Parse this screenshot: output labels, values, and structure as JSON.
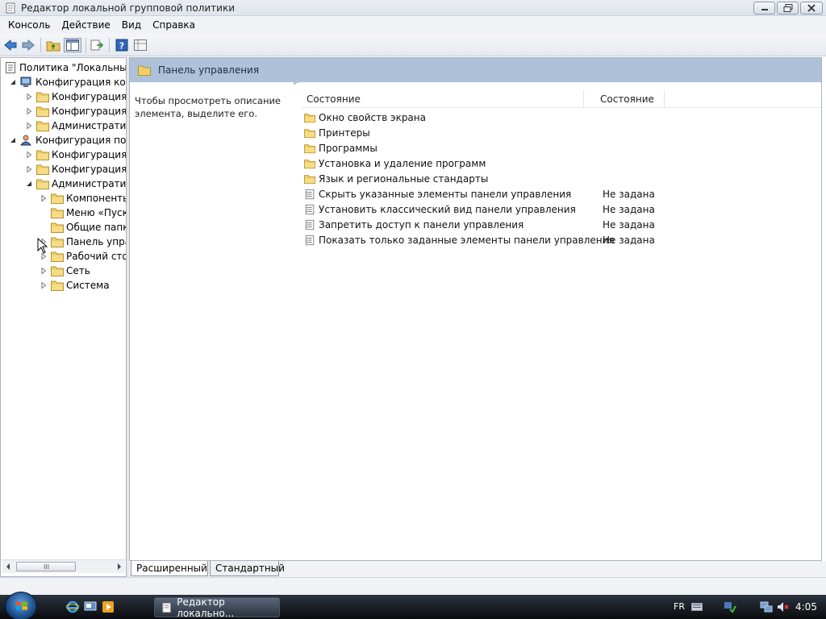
{
  "window": {
    "title": "Редактор локальной групповой политики",
    "title_icon": "policy-editor-icon",
    "controls": [
      "minimize-icon",
      "maximize-icon",
      "close-icon"
    ]
  },
  "menu": [
    "Консоль",
    "Действие",
    "Вид",
    "Справка"
  ],
  "toolbar": {
    "buttons": [
      "back-arrow-icon",
      "forward-arrow-icon",
      "up-folder-icon",
      "show-hide-tree-icon",
      "export-list-icon",
      "help-icon",
      "properties-icon"
    ]
  },
  "tree": {
    "items": [
      {
        "label": "Политика \"Локальный",
        "icon": "policy-icon",
        "expander": "none"
      },
      {
        "label": "Конфигурация комп",
        "icon": "computer-icon",
        "expander": "expanded"
      },
      {
        "label": "Конфигурация п",
        "icon": "folder-icon",
        "expander": "collapsed"
      },
      {
        "label": "Конфигурация W",
        "icon": "folder-icon",
        "expander": "collapsed"
      },
      {
        "label": "Административн",
        "icon": "folder-icon",
        "expander": "collapsed"
      },
      {
        "label": "Конфигурация поль",
        "icon": "user-icon",
        "expander": "expanded"
      },
      {
        "label": "Конфигурация п",
        "icon": "folder-icon",
        "expander": "collapsed"
      },
      {
        "label": "Конфигурация W",
        "icon": "folder-icon",
        "expander": "collapsed"
      },
      {
        "label": "Административн",
        "icon": "folder-icon",
        "expander": "expanded"
      },
      {
        "label": "Компоненты",
        "icon": "folder-icon",
        "expander": "collapsed"
      },
      {
        "label": "Меню «Пуск",
        "icon": "folder-icon",
        "expander": "none"
      },
      {
        "label": "Общие папки",
        "icon": "folder-icon",
        "expander": "none"
      },
      {
        "label": "Панель упра",
        "icon": "folder-icon",
        "expander": "collapsed"
      },
      {
        "label": "Рабочий сто",
        "icon": "folder-icon",
        "expander": "collapsed"
      },
      {
        "label": "Сеть",
        "icon": "folder-icon",
        "expander": "collapsed"
      },
      {
        "label": "Система",
        "icon": "folder-icon",
        "expander": "collapsed"
      }
    ],
    "scroll_grip": "III"
  },
  "right_pane": {
    "header_title": "Панель управления",
    "header_icon": "folder-icon",
    "description": "Чтобы просмотреть описание элемента, выделите его.",
    "columns": [
      "Состояние",
      "Состояние"
    ],
    "rows": [
      {
        "name": "Окно свойств экрана",
        "state": "",
        "icon": "folder-icon"
      },
      {
        "name": "Принтеры",
        "state": "",
        "icon": "folder-icon"
      },
      {
        "name": "Программы",
        "state": "",
        "icon": "folder-icon"
      },
      {
        "name": "Установка и удаление программ",
        "state": "",
        "icon": "folder-icon"
      },
      {
        "name": "Язык и региональные стандарты",
        "state": "",
        "icon": "folder-icon"
      },
      {
        "name": "Скрыть указанные элементы панели управления",
        "state": "Не задана",
        "icon": "setting-icon"
      },
      {
        "name": "Установить классический вид панели управления",
        "state": "Не задана",
        "icon": "setting-icon"
      },
      {
        "name": "Запретить доступ к панели управления",
        "state": "Не задана",
        "icon": "setting-icon"
      },
      {
        "name": "Показать только заданные элементы панели управления",
        "state": "Не задана",
        "icon": "setting-icon"
      }
    ]
  },
  "tabs": [
    "Расширенный",
    "Стандартный"
  ],
  "taskbar": {
    "task_label": "Редактор локально...",
    "language": "FR",
    "clock": "4:05",
    "quick_launch": [
      "internet-explorer-icon",
      "show-desktop-icon",
      "media-player-icon"
    ],
    "tray_icons": [
      "keyboard-icon",
      "security-center-icon",
      "network-icon",
      "volume-muted-icon"
    ]
  }
}
